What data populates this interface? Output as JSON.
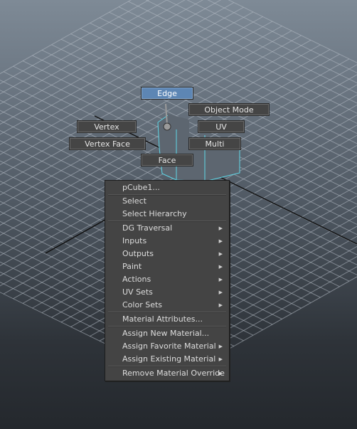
{
  "marking_menu": {
    "edge": "Edge",
    "object_mode": "Object Mode",
    "vertex": "Vertex",
    "uv": "UV",
    "vertex_face": "Vertex Face",
    "multi": "Multi",
    "face": "Face",
    "active_item": "Edge"
  },
  "context_menu": {
    "header": "pCube1...",
    "items": [
      {
        "label": "Select",
        "submenu": false
      },
      {
        "label": "Select Hierarchy",
        "submenu": false
      },
      {
        "label": "DG Traversal",
        "submenu": true
      },
      {
        "label": "Inputs",
        "submenu": true
      },
      {
        "label": "Outputs",
        "submenu": true
      },
      {
        "label": "Paint",
        "submenu": true
      },
      {
        "label": "Actions",
        "submenu": true
      },
      {
        "label": "UV Sets",
        "submenu": true
      },
      {
        "label": "Color Sets",
        "submenu": true
      },
      {
        "label": "Material Attributes...",
        "submenu": false
      },
      {
        "label": "Assign New Material...",
        "submenu": false
      },
      {
        "label": "Assign Favorite Material",
        "submenu": true
      },
      {
        "label": "Assign Existing Material",
        "submenu": true
      },
      {
        "label": "Remove Material Override",
        "submenu": true
      }
    ]
  },
  "icons": {
    "submenu_arrow": "submenu-arrow-icon"
  },
  "colors": {
    "highlight": "#5d86b4",
    "wireframe_selected": "#5fd8e8",
    "grid": "#b4bcc4",
    "axis": "#111111"
  }
}
